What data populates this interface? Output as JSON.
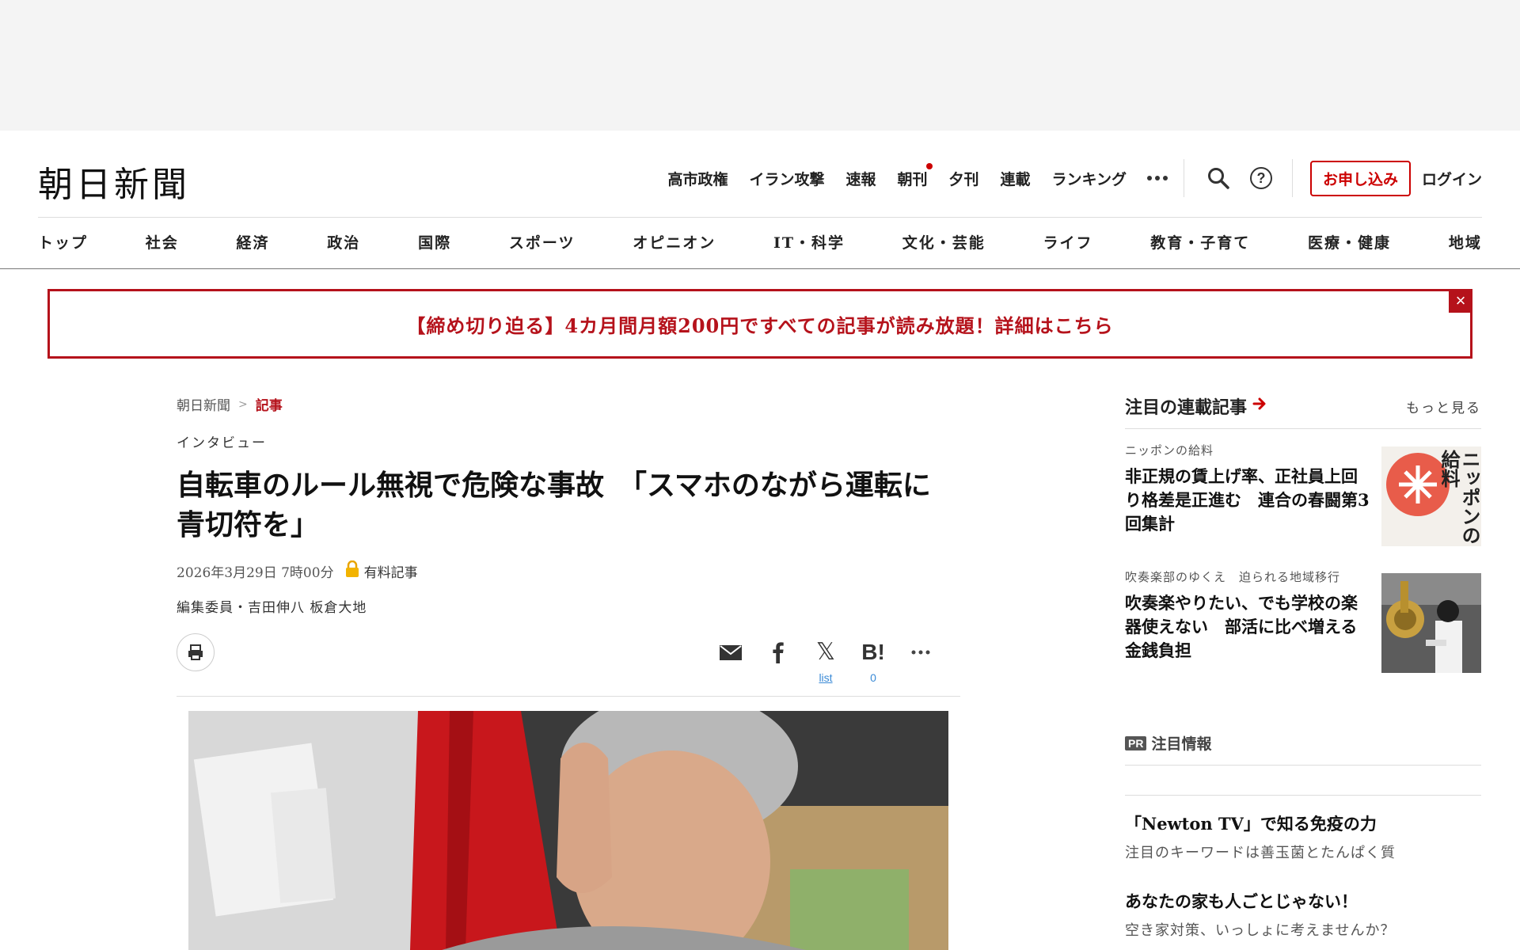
{
  "header": {
    "logo": "朝日新聞",
    "top_nav": [
      "高市政権",
      "イラン攻撃",
      "速報",
      "朝刊",
      "夕刊",
      "連載",
      "ランキング"
    ],
    "apply_label": "お申し込み",
    "login_label": "ログイン"
  },
  "categories": [
    "トップ",
    "社会",
    "経済",
    "政治",
    "国際",
    "スポーツ",
    "オピニオン",
    "IT・科学",
    "文化・芸能",
    "ライフ",
    "教育・子育て",
    "医療・健康",
    "地域"
  ],
  "banner": {
    "text": "【締め切り迫る】4カ月間月額200円ですべての記事が読み放題！詳細はこちら",
    "close_label": "×"
  },
  "article": {
    "breadcrumb": [
      "朝日新聞",
      "記事"
    ],
    "breadcrumb_sep": ">",
    "genre": "インタビュー",
    "headline": "自転車のルール無視で危険な事故　「スマホのながら運転に青切符を」",
    "date": "2026年3月29日 7時00分",
    "paid_label": "有料記事",
    "author": "編集委員・吉田伸八 板倉大地",
    "share": {
      "x_count": "list",
      "hatena_count": "0",
      "hatena_label": "B!"
    }
  },
  "sidebar": {
    "title": "注目の連載記事",
    "more": "もっと見る",
    "items": [
      {
        "label": "ニッポンの給料",
        "title": "非正規の賃上げ率、正社員上回り格差是正進む　連合の春闘第3回集計",
        "thumb_text": "ニッポンの給料"
      },
      {
        "label": "吹奏楽部のゆくえ　迫られる地域移行",
        "title": "吹奏楽やりたい、でも学校の楽器使えない　部活に比べ増える金銭負担"
      }
    ]
  },
  "pr": {
    "badge": "PR",
    "title": "注目情報",
    "items": [
      {
        "title": "「Newton TV」で知る免疫の力",
        "sub": "注目のキーワードは善玉菌とたんぱく質"
      },
      {
        "title": "あなたの家も人ごとじゃない！",
        "sub": "空き家対策、いっしょに考えませんか？"
      }
    ]
  },
  "colors": {
    "brand_red": "#b5121b",
    "link_blue": "#3a8ad6"
  }
}
